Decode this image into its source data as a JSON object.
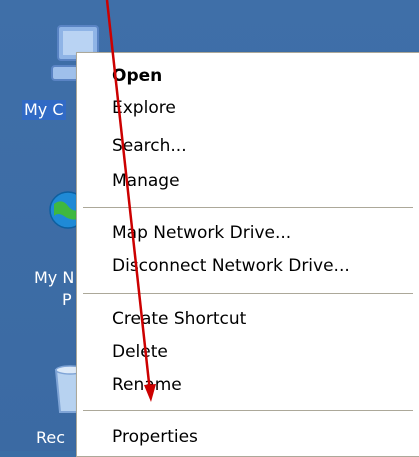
{
  "desktop": {
    "icons": [
      {
        "label": "My C",
        "icon": "my-computer-icon"
      },
      {
        "label_line1": "My N",
        "label_line2": "P",
        "icon": "my-network-places-icon"
      },
      {
        "label": "Rec",
        "icon": "recycle-bin-icon"
      }
    ]
  },
  "context_menu": {
    "items": [
      {
        "label": "Open",
        "default": true
      },
      {
        "label": "Explore"
      },
      {
        "label": "Search..."
      },
      {
        "label": "Manage"
      },
      {
        "label": "Map Network Drive..."
      },
      {
        "label": "Disconnect Network Drive..."
      },
      {
        "label": "Create Shortcut"
      },
      {
        "label": "Delete"
      },
      {
        "label": "Rename"
      },
      {
        "label": "Properties"
      }
    ]
  },
  "annotation": {
    "arrow_color": "#cc0000"
  }
}
